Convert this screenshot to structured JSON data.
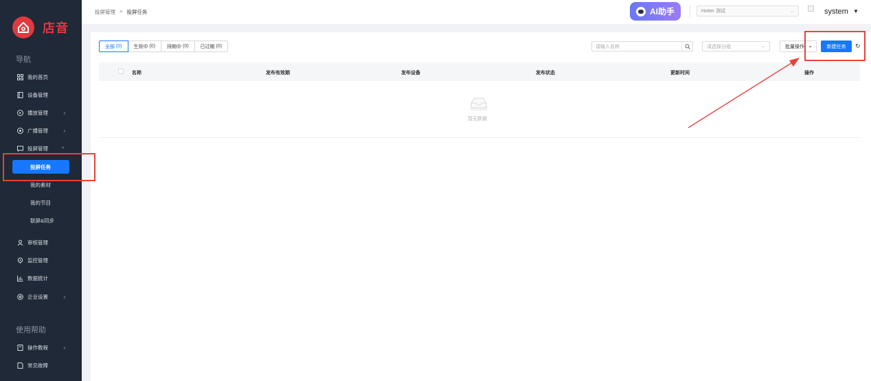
{
  "brand": {
    "name": "店音"
  },
  "sidebar": {
    "nav_title": "导航",
    "items": [
      {
        "label": "我的首页",
        "icon": "grid-icon"
      },
      {
        "label": "设备管理",
        "icon": "device-icon"
      },
      {
        "label": "播放管理",
        "icon": "play-icon",
        "arrow": "›"
      },
      {
        "label": "广播管理",
        "icon": "broadcast-icon",
        "arrow": "›"
      },
      {
        "label": "投屏管理",
        "icon": "cast-icon",
        "arrow": "⌄"
      }
    ],
    "sub_items": [
      {
        "label": "投屏任务",
        "active": true
      },
      {
        "label": "我的素材"
      },
      {
        "label": "我的节目"
      },
      {
        "label": "联屏&同步"
      }
    ],
    "items2": [
      {
        "label": "审核管理",
        "icon": "audit-icon"
      },
      {
        "label": "监控管理",
        "icon": "monitor-icon"
      },
      {
        "label": "数据统计",
        "icon": "chart-icon"
      },
      {
        "label": "企业设置",
        "icon": "settings-icon",
        "arrow": "›"
      }
    ],
    "help_title": "使用帮助",
    "help_items": [
      {
        "label": "操作教程",
        "icon": "book-icon",
        "arrow": "›"
      },
      {
        "label": "常见故障",
        "icon": "doc-icon"
      }
    ]
  },
  "header": {
    "breadcrumb": [
      "投屏管理",
      ">",
      "投屏任务"
    ],
    "ai_label": "AI助手",
    "org_select": "Hotter 测试",
    "user": "system",
    "caret": "▼"
  },
  "toolbar": {
    "tabs": [
      {
        "label": "全部",
        "count": "(0)",
        "active": true
      },
      {
        "label": "生效中",
        "count": "(0)"
      },
      {
        "label": "排期中",
        "count": "(0)"
      },
      {
        "label": "已过期",
        "count": "(0)"
      }
    ],
    "search_placeholder": "请输入名称",
    "group_placeholder": "请选择分组",
    "batch_label": "批量操作",
    "new_label": "新建任务",
    "refresh": "↻"
  },
  "table": {
    "columns": [
      "名称",
      "发布有效期",
      "发布设备",
      "发布状态",
      "更新时间",
      "操作"
    ],
    "empty_text": "暂无数据"
  },
  "colors": {
    "sidebar_bg": "#1f2937",
    "accent": "#1677ff",
    "brand_red": "#e0393e",
    "annotation_red": "#e8413b"
  }
}
